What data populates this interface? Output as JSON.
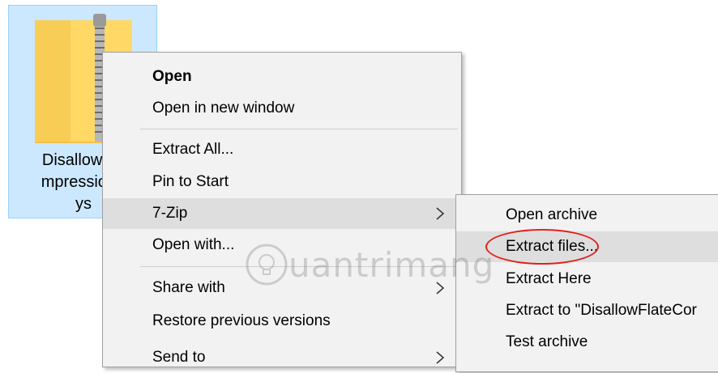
{
  "desktop_file": {
    "name_lines": "DisallowFla\nmpressionF\nys",
    "icon": "zip-folder-icon"
  },
  "context_menu": {
    "items": [
      {
        "label": "Open",
        "bold": true
      },
      {
        "label": "Open in new window"
      },
      {
        "label": "Extract All..."
      },
      {
        "label": "Pin to Start"
      },
      {
        "label": "7-Zip",
        "submenu": true
      },
      {
        "label": "Open with..."
      },
      {
        "label": "Share with",
        "submenu": true
      },
      {
        "label": "Restore previous versions"
      },
      {
        "label": "Send to",
        "submenu": true
      }
    ]
  },
  "submenu_7zip": {
    "items": [
      {
        "label": "Open archive"
      },
      {
        "label": "Extract files..."
      },
      {
        "label": "Extract Here"
      },
      {
        "label": "Extract to \"DisallowFlateCor"
      },
      {
        "label": "Test archive"
      }
    ]
  },
  "watermark": {
    "text": "uantrimang",
    "icon": "lightbulb-icon"
  },
  "colors": {
    "selection": "#cce8ff",
    "menu_bg": "#f2f2f2",
    "hover": "#dedede",
    "ring": "#e0201b"
  }
}
